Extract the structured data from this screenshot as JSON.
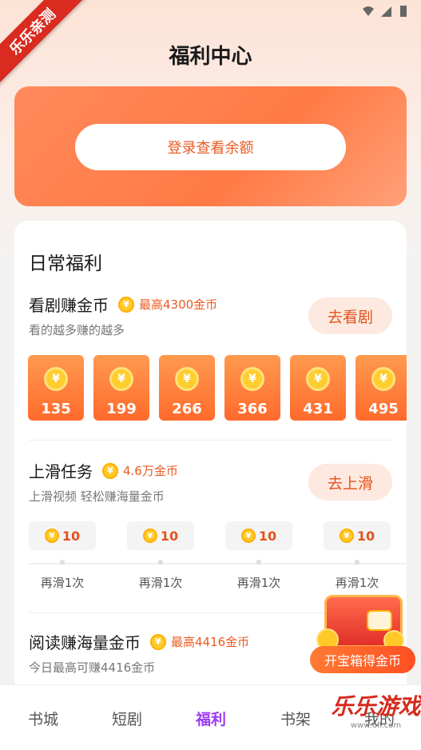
{
  "watermark_corner": "乐乐亲测",
  "page_title": "福利中心",
  "balance": {
    "login_label": "登录查看余额"
  },
  "daily": {
    "title": "日常福利",
    "watch": {
      "name": "看剧赚金币",
      "reward": "最高4300金币",
      "desc": "看的越多赚的越多",
      "button": "去看剧",
      "tiles": [
        "135",
        "199",
        "266",
        "366",
        "431",
        "495"
      ]
    },
    "swipe": {
      "name": "上滑任务",
      "reward": "4.6万金币",
      "desc": "上滑视频 轻松赚海量金币",
      "button": "去上滑",
      "items": [
        {
          "amount": "10",
          "label": "再滑1次"
        },
        {
          "amount": "10",
          "label": "再滑1次"
        },
        {
          "amount": "10",
          "label": "再滑1次"
        },
        {
          "amount": "10",
          "label": "再滑1次"
        }
      ]
    },
    "read": {
      "name": "阅读赚海量金币",
      "reward": "最高4416金币",
      "desc": "今日最高可赚4416金币"
    }
  },
  "treasure": {
    "label": "开宝箱得金币"
  },
  "tabs": [
    "书城",
    "短剧",
    "福利",
    "书架",
    "我的"
  ],
  "active_tab": "福利",
  "watermark_br": {
    "title": "乐乐游戏",
    "sub": "www.6ll.com"
  },
  "colors": {
    "accent": "#ea5a23",
    "active_tab": "#9b3df0",
    "card": "#ff7a45"
  }
}
